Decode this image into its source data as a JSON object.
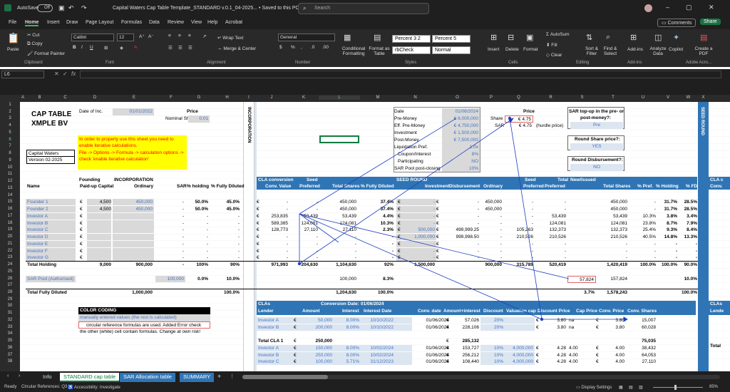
{
  "titlebar": {
    "autosave": "AutoSave",
    "autosave_state": "Off",
    "doc_title": "Capital Waters Cap Table Template_STANDARD v.0.1_04-2025... • Saved to this PC",
    "search_placeholder": "Search"
  },
  "menu": [
    "File",
    "Home",
    "Insert",
    "Draw",
    "Page Layout",
    "Formulas",
    "Data",
    "Review",
    "View",
    "Help",
    "Acrobat"
  ],
  "menu_right": {
    "comments": "Comments",
    "share": "Share"
  },
  "ribbon": {
    "clipboard": {
      "paste": "Paste",
      "cut": "Cut",
      "copy": "Copy",
      "format_painter": "Format Painter",
      "label": "Clipboard"
    },
    "font": {
      "name": "Calibri",
      "size": "12",
      "label": "Font"
    },
    "alignment": {
      "wrap": "Wrap Text",
      "merge": "Merge & Center",
      "label": "Alignment"
    },
    "number": {
      "format": "General",
      "label": "Number"
    },
    "styles": {
      "cond": "Conditional Formatting",
      "table": "Format as Table",
      "s1": "Percent 3 2",
      "s2": "Percent 5",
      "s3": "rbCheck",
      "s4": "Normal",
      "label": "Styles"
    },
    "cells": {
      "insert": "Insert",
      "delete": "Delete",
      "format": "Format",
      "label": "Cells"
    },
    "editing": {
      "autosum": "AutoSum",
      "fill": "Fill",
      "clear": "Clear",
      "sort": "Sort & Filter",
      "find": "Find & Select",
      "label": "Editing"
    },
    "addins": {
      "addins": "Add-ins",
      "label": "Add-ins"
    },
    "analyze": "Analyze Data",
    "copilot": "Copilot",
    "pdf": "Create a PDF",
    "acrobat_label": "Adobe Acro..."
  },
  "namebox": "L6",
  "columns": [
    "A",
    "B",
    "C",
    "D",
    "E",
    "F",
    "G",
    "H",
    "I",
    "J",
    "K",
    "L",
    "M",
    "N",
    "O",
    "P",
    "Q",
    "R",
    "S",
    "T",
    "U",
    "V",
    "W",
    "X"
  ],
  "rows": [
    "1",
    "2",
    "3",
    "4",
    "5",
    "6",
    "7",
    "8",
    "9",
    "10",
    "11",
    "12",
    "13",
    "14",
    "15",
    "16",
    "17",
    "18",
    "19",
    "20",
    "21",
    "22",
    "23",
    "24",
    "25",
    "26",
    "27",
    "28",
    "29",
    "30",
    "31",
    "32",
    "33",
    "34",
    "35",
    "36",
    "37",
    "38"
  ],
  "sheet": {
    "title1": "CAP TABLE",
    "title2": "XMPLE BV",
    "date_inc_label": "Date of Inc.",
    "date_inc": "01/01/2022",
    "price_label": "Price",
    "nominal_label": "Nominal Share",
    "nominal": "0.01",
    "warn1": "In order to properly use this sheet you need to",
    "warn2": "enable iterative calculations.",
    "warn3": "File -> Options -> Formula -> calculation options ->",
    "warn4": "check 'enable iterative calculation'",
    "company": "Capital Waters",
    "version": "Version 02-2025",
    "incorporation_vertical": "INCORPORATION",
    "seed_round_vertical": "SEED ROUND",
    "founding": "Founding",
    "incorporation": "INCORPORATION",
    "hdr_name": "Name",
    "hdr_paid": "Paid-up Capital",
    "hdr_ordinary": "Ordinary",
    "hdr_sar": "SAR",
    "hdr_holding": "% holding",
    "hdr_fd": "% Fully Diluted",
    "cla_conv": "CLA conversion",
    "seed": "Seed",
    "conv_value": "Conv. Value",
    "preferred": "Preferred",
    "total_shares": "Total Shares",
    "pct_fd": "% Fully Diluted",
    "seed_round": "SEED ROUND",
    "seed2": "Seed",
    "total": "Total",
    "new_issued": "New/Issued",
    "investment": "Investment",
    "disbursement": "Disbursement",
    "ordinary2": "Ordinary",
    "pct_pref": "% Pref.",
    "pct_holding": "% Holding",
    "pct_fd2": "% FD",
    "right_block": {
      "date_label": "Date",
      "date": "01/06/2024",
      "price_label": "Price",
      "premoney_label": "Pre-Money",
      "premoney": "€ 6,000,000",
      "share_label": "Share",
      "share_price": "€ 4.75",
      "eff_label": "Eff. Pre-Money",
      "eff": "€ 4,750,000",
      "sar_label": "SAR",
      "sar": "€ 4.75",
      "hurdle": "(hurdle price)",
      "inv_label": "Investment",
      "inv": "€ 1,500,000",
      "post_label": "Post-Money",
      "post": "€ 7,500,000",
      "liq_label": "Liquidation Pref.",
      "liq": "1.0x",
      "coupon_label": "Coupon/Interest",
      "coupon": "8%",
      "part_label": "Participating",
      "part": "NO",
      "sarpool_label": "SAR Pool post-closing",
      "sarpool": "10%"
    },
    "topup_q1": "SAR top-up in the pre- or",
    "topup_q2": "post-money?:",
    "topup_a": "Pre",
    "round_q": "Round Share price?:",
    "round_a": "YES",
    "disb_q": "Round Disbursement?:",
    "disb_a": "NO",
    "cla_col": "CLA c",
    "conv_col": "Conv.",
    "founders": [
      {
        "name": "Founder 1",
        "cur": "€",
        "paid": "4,500",
        "ord": "450,000",
        "sar": "-",
        "hold": "50.0%",
        "fd": "45.0%"
      },
      {
        "name": "Founder 2",
        "cur": "€",
        "paid": "4,500",
        "ord": "450,000",
        "sar": "-",
        "hold": "50.0%",
        "fd": "45.0%"
      }
    ],
    "investors": [
      {
        "name": "Investor A",
        "sar": "-",
        "hold": "-",
        "fd": "-"
      },
      {
        "name": "Investor B",
        "sar": "-",
        "hold": "-",
        "fd": "-"
      },
      {
        "name": "Investor C",
        "sar": "-",
        "hold": "-",
        "fd": "-"
      },
      {
        "name": "Investor D",
        "sar": "-",
        "hold": "-",
        "fd": "-"
      },
      {
        "name": "Investor E",
        "sar": "-",
        "hold": "-",
        "fd": "-"
      },
      {
        "name": "Investor F",
        "sar": "-",
        "hold": "-",
        "fd": "-"
      },
      {
        "name": "Investor G",
        "sar": "-",
        "hold": "-",
        "fd": "-"
      }
    ],
    "mid_rows": [
      {
        "cv": "-",
        "pref": "-",
        "ts": "450,000",
        "fd": "37.4%",
        "inv": "-",
        "dis": "-",
        "ord": "450,000",
        "pr": "-",
        "tp": "-",
        "tt": "450,000",
        "pp": "-",
        "ph": "31.7%",
        "pf": "28.5%"
      },
      {
        "cv": "-",
        "pref": "-",
        "ts": "450,000",
        "fd": "37.4%",
        "inv": "-",
        "dis": "-",
        "ord": "450,000",
        "pr": "-",
        "tp": "-",
        "tt": "450,000",
        "pp": "-",
        "ph": "31.7%",
        "pf": "28.5%"
      },
      {
        "cv": "253,835",
        "pref": "53,439",
        "ts": "53,439",
        "fd": "4.4%",
        "inv": "-",
        "dis": "-",
        "ord": "-",
        "pr": "-",
        "tp": "53,439",
        "tt": "53,439",
        "pp": "10.3%",
        "ph": "3.8%",
        "pf": "3.4%"
      },
      {
        "cv": "589,385",
        "pref": "124,081",
        "ts": "124,081",
        "fd": "10.3%",
        "inv": "-",
        "dis": "-",
        "ord": "-",
        "pr": "-",
        "tp": "124,081",
        "tt": "124,081",
        "pp": "23.8%",
        "ph": "8.7%",
        "pf": "7.9%"
      },
      {
        "cv": "128,773",
        "pref": "27,110",
        "ts": "27,110",
        "fd": "2.3%",
        "inv": "500,000",
        "dis": "499,999.25",
        "ord": "-",
        "pr": "105,263",
        "tp": "132,373",
        "tt": "132,373",
        "pp": "25.4%",
        "ph": "9.3%",
        "pf": "8.4%"
      },
      {
        "cv": "-",
        "pref": "-",
        "ts": "-",
        "fd": "-",
        "inv": "1,000,000",
        "dis": "999,998.50",
        "ord": "-",
        "pr": "210,526",
        "tp": "210,526",
        "tt": "210,526",
        "pp": "40.5%",
        "ph": "14.8%",
        "pf": "13.3%"
      },
      {
        "cv": "-",
        "pref": "-",
        "ts": "-",
        "fd": "-",
        "inv": "-",
        "dis": "-",
        "ord": "-",
        "pr": "-",
        "tp": "-",
        "tt": "-",
        "pp": "-",
        "ph": "-",
        "pf": "-"
      },
      {
        "cv": "-",
        "pref": "-",
        "ts": "-",
        "fd": "-",
        "inv": "-",
        "dis": "-",
        "ord": "-",
        "pr": "-",
        "tp": "-",
        "tt": "-",
        "pp": "-",
        "ph": "-",
        "pf": "-"
      },
      {
        "cv": "-",
        "pref": "-",
        "ts": "-",
        "fd": "-",
        "inv": "-",
        "dis": "-",
        "ord": "-",
        "pr": "-",
        "tp": "-",
        "tt": "-",
        "pp": "-",
        "ph": "-",
        "pf": "-"
      }
    ],
    "total_holding": {
      "label": "Total Holding",
      "paid": "9,000",
      "ord": "900,000",
      "sar": "-",
      "hold": "100%",
      "fd": "90%",
      "cv": "971,993",
      "pref": "204,630",
      "ts": "1,104,630",
      "pfd": "92%",
      "inv": "1,500,000",
      "ordm": "900,000",
      "pr": "315,789",
      "tp": "520,419",
      "tt": "1,420,419",
      "pp": "100.0%",
      "ph": "100.0%",
      "pf": "90.0%"
    },
    "sar_pool": {
      "label": "SAR Pool (Authorised)",
      "sar": "100,000",
      "hold": "0.0%",
      "fd": "10.0%",
      "ts": "100,000",
      "pfd": "8.3%",
      "boxed": "57,824",
      "tt": "157,824",
      "pf": "10.0%"
    },
    "total_fd": {
      "label": "Total Fully Diluted",
      "ord": "1,000,000",
      "fd": "100.0%",
      "ts": "1,204,630",
      "pfd": "100.0%",
      "pp": "3.7%",
      "tt": "1,578,243",
      "pf": "100.0%"
    },
    "color_coding": "COLOR CODING",
    "cc1": "manually entered values (the rest is calculated)",
    "cc2": "circular reference formulas are used. Added Error check",
    "cc3": "the other (white) cell contain formulas. Change at own risk!",
    "clas_hdr": "CLAs",
    "conv_date_label": "Conversion Date:",
    "conv_date": "01/06/2024",
    "lender": "Lender",
    "amount": "Amount",
    "interest": "Interest",
    "int_date": "Interest Date",
    "conv_date_col": "Conv. date",
    "amt_int": "Amount+interest",
    "discount": "Discount",
    "val_cap": "Valuation cap",
    "disc_price": "Discount Price",
    "cap_price": "Cap Price",
    "conv_price": "Conv. Price",
    "conv_shares": "Conv. Shares",
    "clas_right": "CLAs",
    "lender_right": "Lende",
    "total_right": "Total",
    "cla1": [
      {
        "lender": "Investor A",
        "amt": "50,000",
        "int": "8.00%",
        "date": "10/10/2022",
        "cd": "01/06/2024",
        "ai": "57,026",
        "disc": "20%",
        "cap": "",
        "dp": "3.80",
        "na": "na",
        "cp": "3.80",
        "cs": "15,007"
      },
      {
        "lender": "Investor B",
        "amt": "200,000",
        "int": "8.00%",
        "date": "10/10/2022",
        "cd": "01/06/2024",
        "ai": "228,106",
        "disc": "20%",
        "cap": "",
        "dp": "3.80",
        "na": "na",
        "cp": "3.80",
        "cs": "60,028"
      }
    ],
    "total_cla1": {
      "label": "Total CLA 1",
      "amt": "250,000",
      "ai": "285,132",
      "cs": "75,035"
    },
    "cla2": [
      {
        "lender": "Investor A",
        "amt": "150,000",
        "int": "8.00%",
        "date": "10/02/2024",
        "cd": "01/06/2024",
        "ai": "153,727",
        "disc": "10%",
        "cap": "4,000,000",
        "dp": "4.28",
        "na": "4.00",
        "cp": "4.00",
        "cs": "38,432"
      },
      {
        "lender": "Investor B",
        "amt": "250,000",
        "int": "8.00%",
        "date": "10/02/2024",
        "cd": "01/06/2024",
        "ai": "256,212",
        "disc": "10%",
        "cap": "4,000,000",
        "dp": "4.28",
        "na": "4.00",
        "cp": "4.00",
        "cs": "64,053"
      },
      {
        "lender": "Investor C",
        "amt": "100,000",
        "int": "5.71%",
        "date": "31/12/2023",
        "cd": "01/06/2024",
        "ai": "108,440",
        "disc": "10%",
        "cap": "4,000,000",
        "dp": "4.28",
        "na": "4.00",
        "cp": "4.00",
        "cs": "27,110"
      }
    ]
  },
  "tabs": [
    "Info",
    "STANDARD cap table",
    "SAR Allocation table",
    "SUMMARY"
  ],
  "status": {
    "ready": "Ready",
    "circ": "Circular References: Q3",
    "access": "Accessibility: Investigate",
    "display": "Display Settings",
    "zoom": "85%"
  }
}
